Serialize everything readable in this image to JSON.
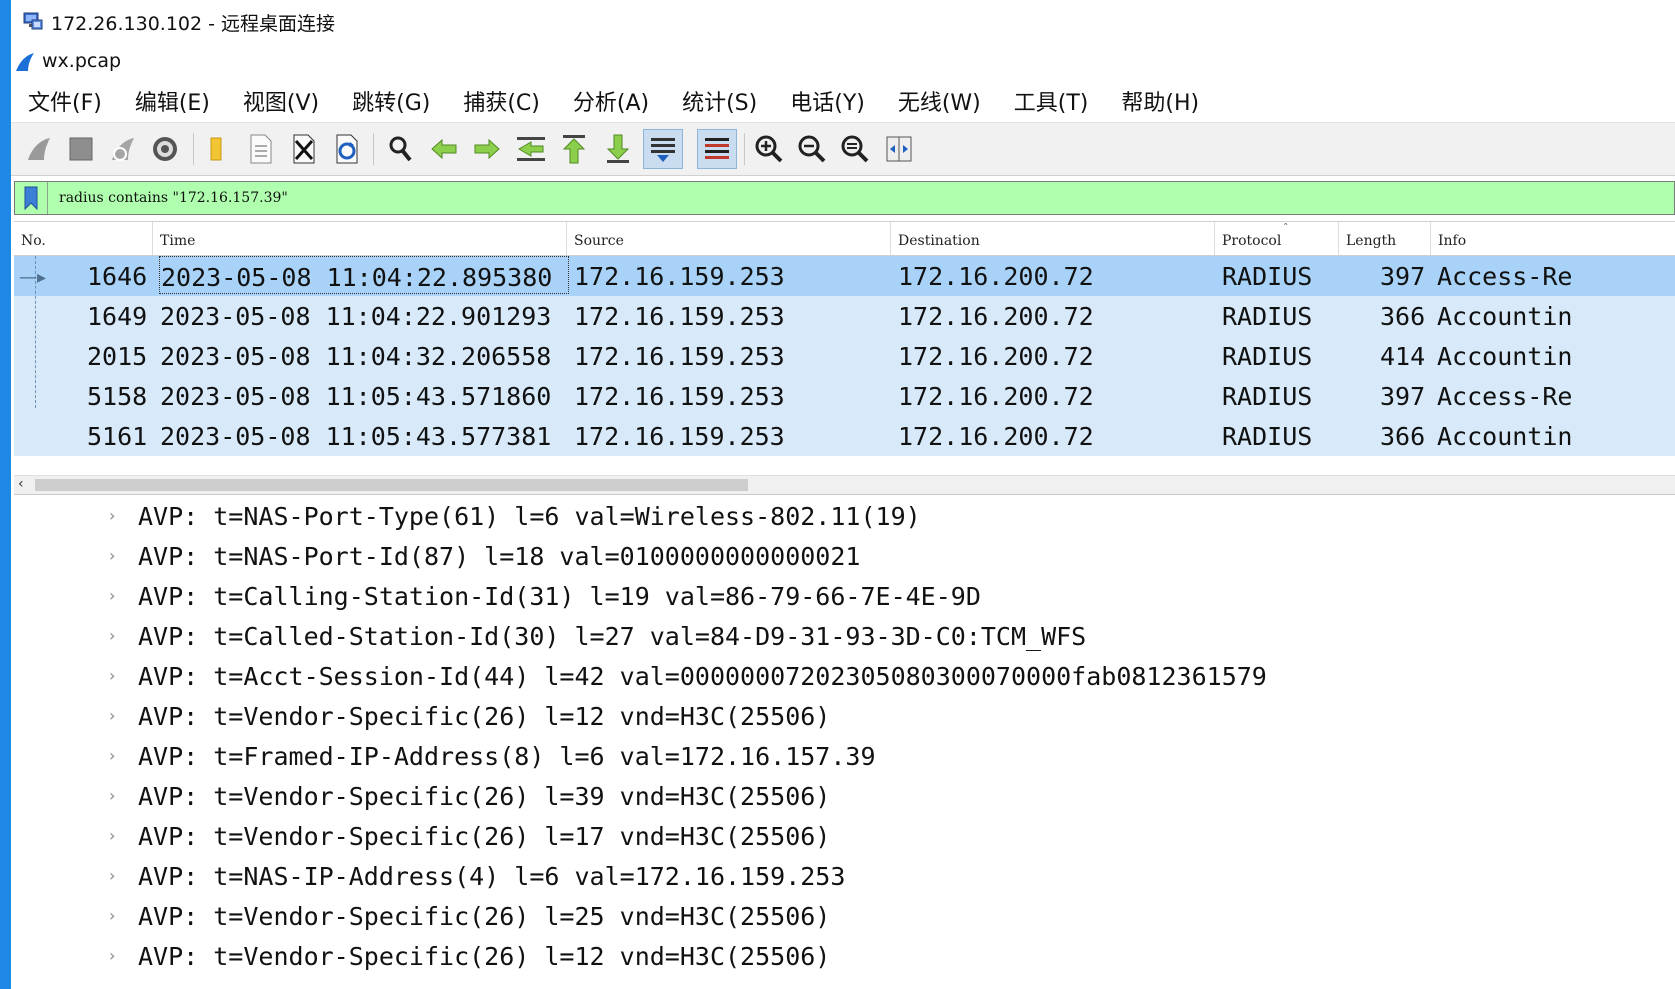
{
  "window": {
    "rdp_title": "172.26.130.102 - 远程桌面连接",
    "app_title": "wx.pcap"
  },
  "menu": [
    "文件(F)",
    "编辑(E)",
    "视图(V)",
    "跳转(G)",
    "捕获(C)",
    "分析(A)",
    "统计(S)",
    "电话(Y)",
    "无线(W)",
    "工具(T)",
    "帮助(H)"
  ],
  "toolbar": {
    "icons": [
      "shark-fin-start-icon",
      "stop-square-icon",
      "restart-fin-icon",
      "capture-options-gear-icon",
      "open-folder-icon",
      "save-file-icon",
      "close-file-icon",
      "reload-icon",
      "find-packet-icon",
      "go-back-icon",
      "go-forward-icon",
      "go-to-packet-icon",
      "go-first-icon",
      "go-last-icon",
      "autoscroll-icon",
      "colorize-icon",
      "zoom-in-icon",
      "zoom-out-icon",
      "zoom-normal-icon",
      "resize-columns-icon"
    ]
  },
  "filter": {
    "text": "radius contains \"172.16.157.39\"",
    "bg_color": "#afffaf"
  },
  "packet_list": {
    "columns": [
      "No.",
      "Time",
      "Source",
      "Destination",
      "Protocol",
      "Length",
      "Info"
    ],
    "rows": [
      {
        "no": "1646",
        "time": "2023-05-08 11:04:22.895380",
        "source": "172.16.159.253",
        "destination": "172.16.200.72",
        "protocol": "RADIUS",
        "length": "397",
        "info": "Access-Re"
      },
      {
        "no": "1649",
        "time": "2023-05-08 11:04:22.901293",
        "source": "172.16.159.253",
        "destination": "172.16.200.72",
        "protocol": "RADIUS",
        "length": "366",
        "info": "Accountin"
      },
      {
        "no": "2015",
        "time": "2023-05-08 11:04:32.206558",
        "source": "172.16.159.253",
        "destination": "172.16.200.72",
        "protocol": "RADIUS",
        "length": "414",
        "info": "Accountin"
      },
      {
        "no": "5158",
        "time": "2023-05-08 11:05:43.571860",
        "source": "172.16.159.253",
        "destination": "172.16.200.72",
        "protocol": "RADIUS",
        "length": "397",
        "info": "Access-Re"
      },
      {
        "no": "5161",
        "time": "2023-05-08 11:05:43.577381",
        "source": "172.16.159.253",
        "destination": "172.16.200.72",
        "protocol": "RADIUS",
        "length": "366",
        "info": "Accountin"
      }
    ],
    "row_color": "#d8eafa",
    "selected_color": "#a8d2f7"
  },
  "details": {
    "avps": [
      "AVP: t=NAS-Port-Type(61) l=6 val=Wireless-802.11(19)",
      "AVP: t=NAS-Port-Id(87) l=18 val=0100000000000021",
      "AVP: t=Calling-Station-Id(31) l=19 val=86-79-66-7E-4E-9D",
      "AVP: t=Called-Station-Id(30) l=27 val=84-D9-31-93-3D-C0:TCM_WFS",
      "AVP: t=Acct-Session-Id(44) l=42 val=00000007202305080300070000fab0812361579",
      "AVP: t=Vendor-Specific(26) l=12 vnd=H3C(25506)",
      "AVP: t=Framed-IP-Address(8) l=6 val=172.16.157.39",
      "AVP: t=Vendor-Specific(26) l=39 vnd=H3C(25506)",
      "AVP: t=Vendor-Specific(26) l=17 vnd=H3C(25506)",
      "AVP: t=NAS-IP-Address(4) l=6 val=172.16.159.253",
      "AVP: t=Vendor-Specific(26) l=25 vnd=H3C(25506)",
      "AVP: t=Vendor-Specific(26) l=12 vnd=H3C(25506)"
    ]
  }
}
